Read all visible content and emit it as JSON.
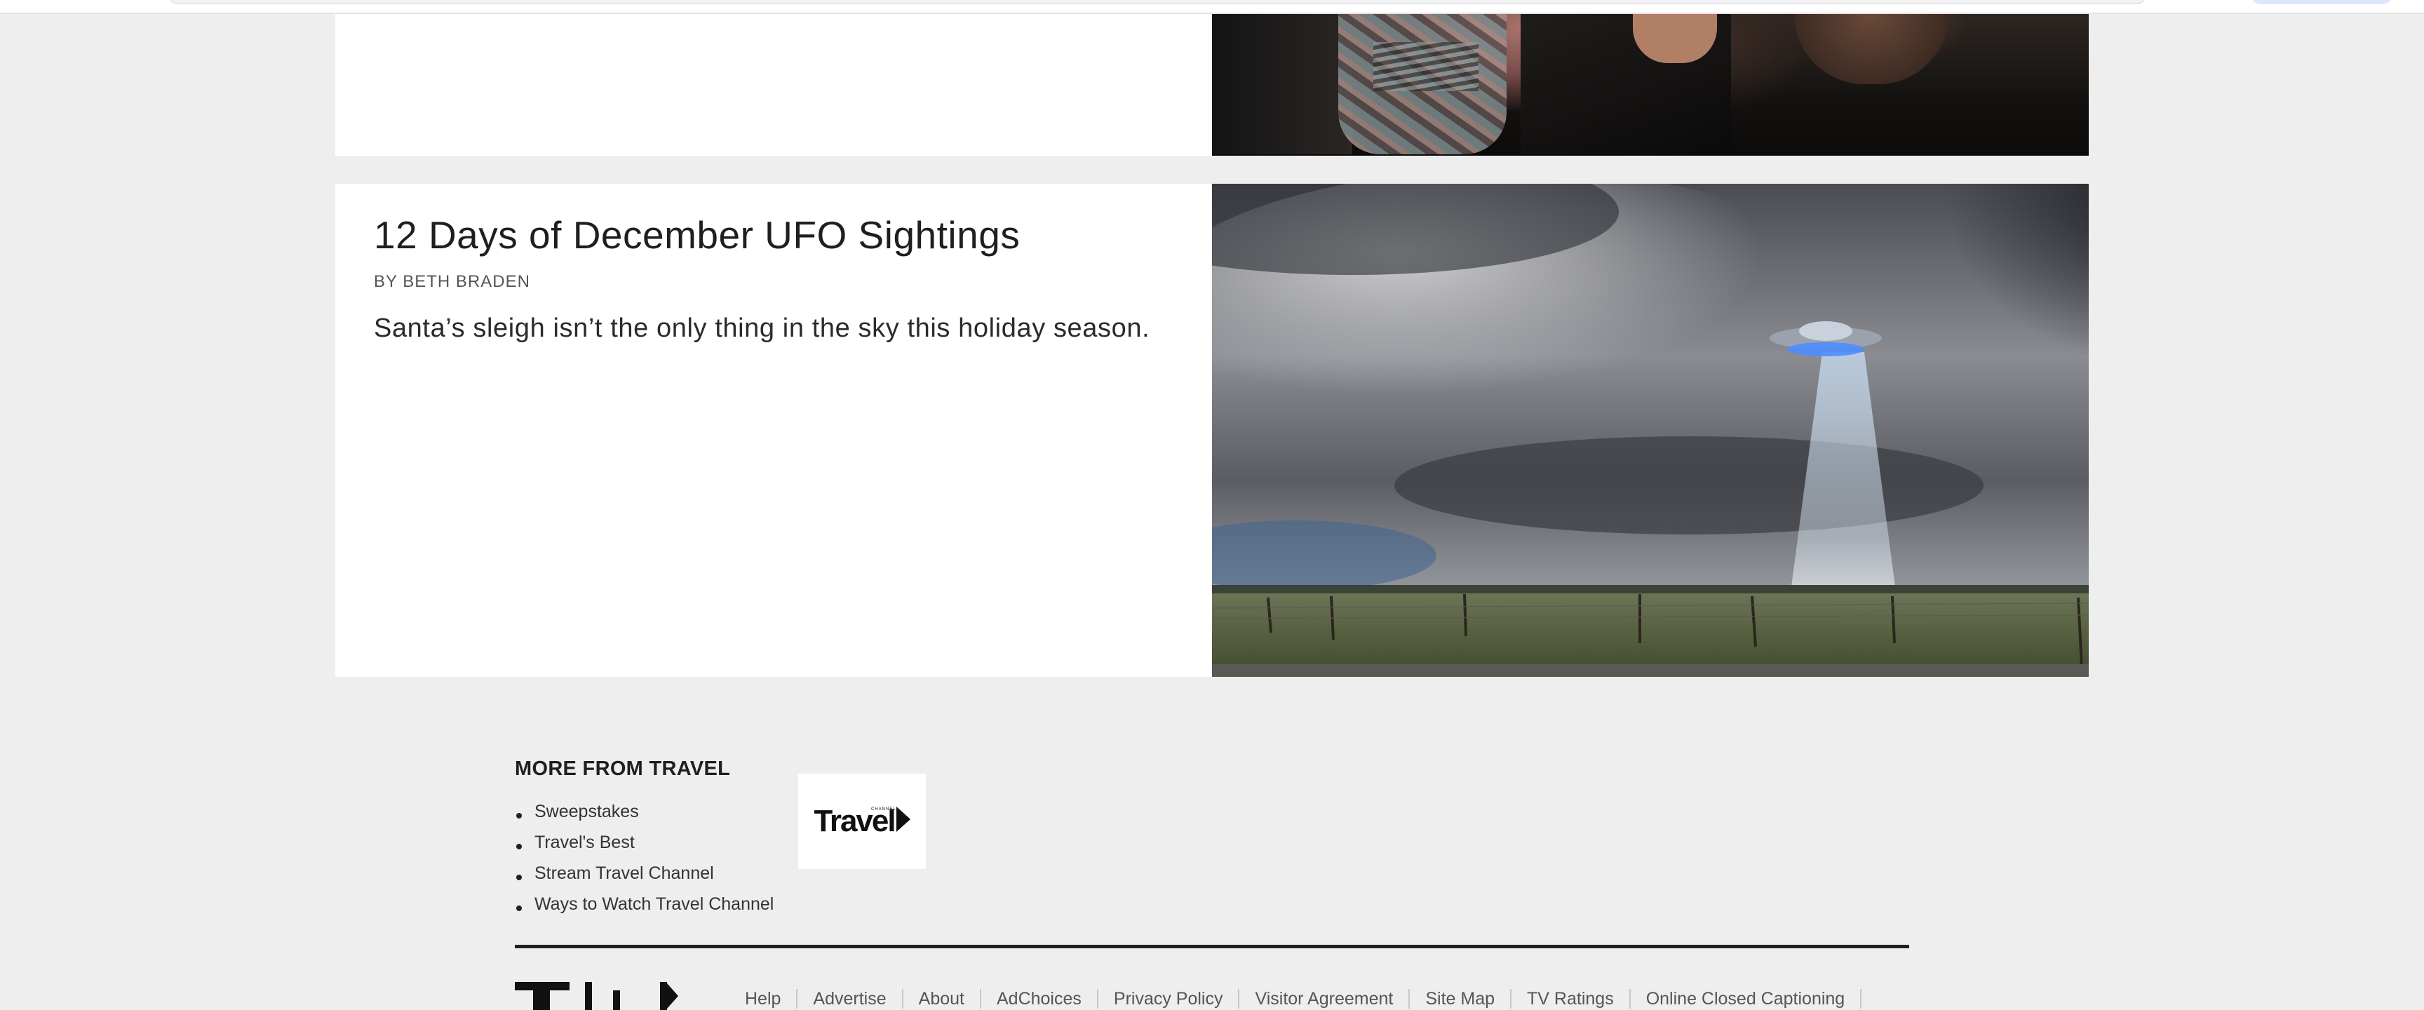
{
  "cards": [
    {
      "image_alt": "Close-up of people wearing dark jackets and a patterned shirt"
    },
    {
      "headline": "12 Days of December UFO Sightings",
      "byline": "BY BETH BRADEN",
      "dek": "Santa’s sleigh isn’t the only thing in the sky this holiday season.",
      "image_alt": "UFO beaming light onto a field under a stormy sky"
    }
  ],
  "more_from": {
    "title": "MORE FROM TRAVEL",
    "links": [
      "Sweepstakes",
      "Travel's Best",
      "Stream Travel Channel",
      "Ways to Watch Travel Channel"
    ],
    "brand_logo_text": "Travel",
    "brand_logo_sub": "CHANNEL"
  },
  "footer": {
    "links": [
      "Help",
      "Advertise",
      "About",
      "AdChoices",
      "Privacy Policy",
      "Visitor Agreement",
      "Site Map",
      "TV Ratings",
      "Online Closed Captioning"
    ]
  },
  "colors": {
    "page_bg": "#eeeeee",
    "card_bg": "#ffffff",
    "rule": "#1f1f1f"
  }
}
